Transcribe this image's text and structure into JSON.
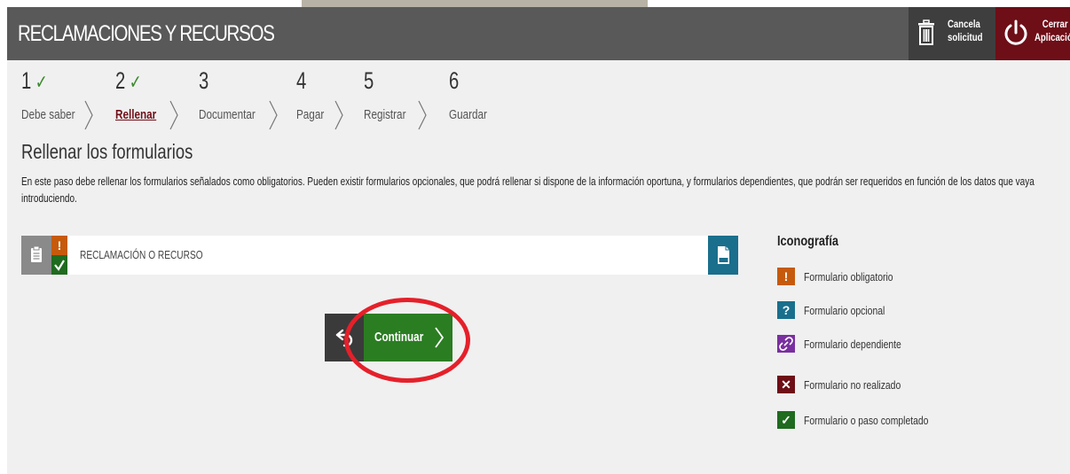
{
  "header": {
    "title": "RECLAMACIONES Y RECURSOS",
    "cancel": {
      "line1": "Cancela",
      "line2": "solicitud",
      "icon": "trash-icon"
    },
    "close": {
      "line1": "Cerrar",
      "line2": "Aplicación",
      "icon": "power-icon"
    }
  },
  "steps": [
    {
      "number": "1",
      "check": "✓",
      "label": "Debe saber",
      "done": true,
      "active": false
    },
    {
      "number": "2",
      "check": "✓",
      "label": "Rellenar",
      "done": true,
      "active": true
    },
    {
      "number": "3",
      "check": "",
      "label": "Documentar",
      "done": false,
      "active": false
    },
    {
      "number": "4",
      "check": "",
      "label": "Pagar",
      "done": false,
      "active": false
    },
    {
      "number": "5",
      "check": "",
      "label": "Registrar",
      "done": false,
      "active": false
    },
    {
      "number": "6",
      "check": "",
      "label": "Guardar",
      "done": false,
      "active": false
    }
  ],
  "section": {
    "title": "Rellenar los formularios",
    "intro": "En este paso debe rellenar los formularios señalados como obligatorios. Pueden existir formularios opcionales, que podrá rellenar si dispone de la información oportuna, y formularios dependientes, que podrán ser requeridos en función de los datos que vaya introduciendo."
  },
  "form": {
    "name": "RECLAMACIÓN O RECURSO",
    "mandatory_mark": "!",
    "status": "completado",
    "xml_icon": "xml-file-icon"
  },
  "legend": {
    "title": "Iconografía",
    "items": [
      {
        "symbol": "!",
        "label": "Formulario obligatorio",
        "color": "#c65a0c"
      },
      {
        "symbol": "?",
        "label": "Formulario opcional",
        "color": "#1a6f8c"
      },
      {
        "symbol": "🔗",
        "label": "Formulario dependiente",
        "color": "#7a2fa0"
      },
      {
        "symbol": "✕",
        "label": "Formulario no realizado",
        "color": "#6e0e17"
      },
      {
        "symbol": "✓",
        "label": "Formulario o paso completado",
        "color": "#1f6b1f"
      }
    ]
  },
  "actions": {
    "continue_label": "Continuar",
    "back_icon": "undo-icon"
  },
  "colors": {
    "header_bg": "#595959",
    "accent_red": "#6e0e17",
    "continue_green": "#2b7d22",
    "highlight_red": "#e5202a"
  }
}
